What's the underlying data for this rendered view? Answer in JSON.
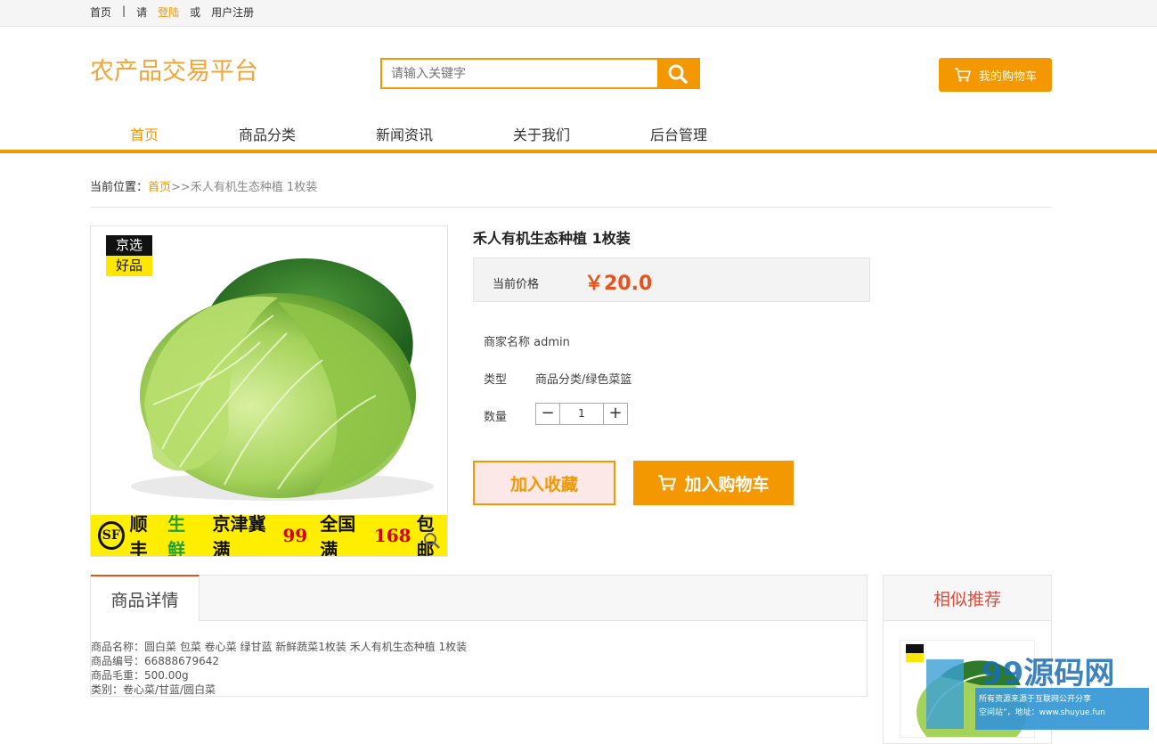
{
  "topbar": {
    "home": "首页",
    "sep": "|",
    "please": "请",
    "login": "登陆",
    "or": "或",
    "register": "用户注册"
  },
  "brand": "农产品交易平台",
  "search": {
    "placeholder": "请输入关键字"
  },
  "cart_label": "我的购物车",
  "nav": [
    "首页",
    "商品分类",
    "新闻资讯",
    "关于我们",
    "后台管理"
  ],
  "breadcrumb": {
    "prefix": "当前位置：",
    "home": "首页",
    "rest": ">>禾人有机生态种植 1枚装"
  },
  "product": {
    "badge_top": "京选",
    "badge_bottom": "好品",
    "banner": {
      "sf": "SF",
      "t1": "顺丰",
      "t2": "生鲜",
      "t3": "京津冀满",
      "t4": "99",
      "t5": "全国满",
      "t6": "168",
      "t7": "包邮"
    },
    "title": "禾人有机生态种植 1枚装",
    "price_label": "当前价格",
    "price": "￥20.0",
    "merchant": "商家名称 admin",
    "type_label": "类型",
    "type_value": "商品分类/绿色菜篮",
    "qty_label": "数量",
    "qty_minus": "−",
    "qty_value": "1",
    "qty_plus": "+",
    "fav_label": "加入收藏",
    "addcart_label": "加入购物车"
  },
  "detail": {
    "tab": "商品详情",
    "lines": [
      "商品名称：圆白菜 包菜 卷心菜 绿甘蓝 新鲜蔬菜1枚装 禾人有机生态种植 1枚装",
      "商品编号：66888679642",
      "商品毛重：500.00g",
      "类别：卷心菜/甘蓝/圆白菜"
    ]
  },
  "recommend": {
    "title": "相似推荐"
  },
  "watermark": {
    "logo": "99源码网",
    "line1": "所有资源来源于互联网公开分享",
    "line2": "空间站”，地址：www.shuyue.fun"
  },
  "colors": {
    "accent": "#f39800",
    "price": "#e8531c",
    "recommend": "#e14b3a"
  }
}
